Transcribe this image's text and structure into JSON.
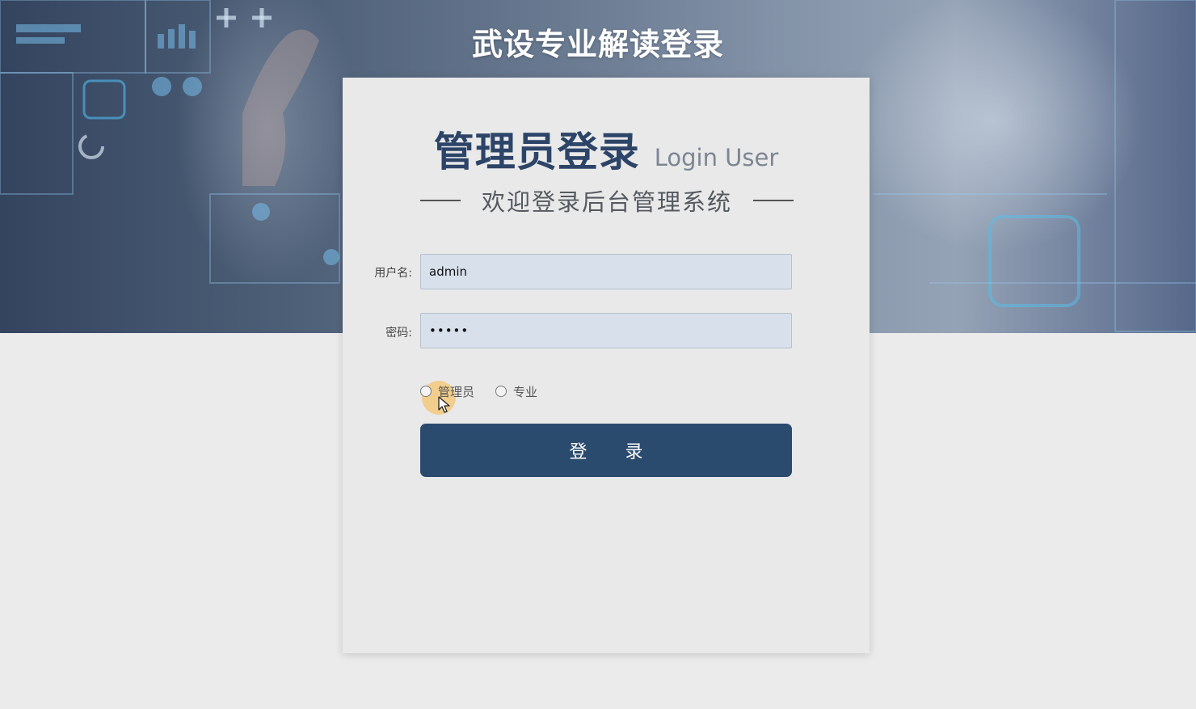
{
  "header": {
    "site_title": "武设专业解读登录"
  },
  "login_card": {
    "title": "管理员登录",
    "title_en": "Login User",
    "subtitle": "欢迎登录后台管理系统",
    "username": {
      "label": "用户名:",
      "value": "admin"
    },
    "password": {
      "label": "密码:",
      "value": "•••••"
    },
    "roles": [
      {
        "label": "管理员",
        "selected": false
      },
      {
        "label": "专业",
        "selected": false
      }
    ],
    "login_button": "登 录"
  },
  "colors": {
    "accent": "#2a4a6e",
    "title": "#2c4468",
    "input_bg": "#d8e0ec",
    "page_bg": "#ebebeb"
  }
}
